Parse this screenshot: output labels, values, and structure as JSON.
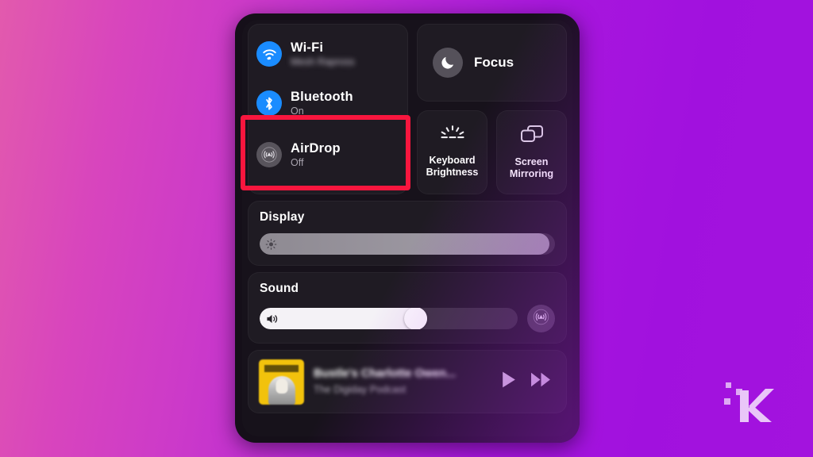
{
  "background": {
    "gradient_from": "#e25aad",
    "gradient_to": "#a313de"
  },
  "panel": {
    "name": "macos-control-center",
    "toggles": [
      {
        "id": "wifi",
        "icon": "wifi-icon",
        "label": "Wi-Fi",
        "status": "Mesh Rapross",
        "status_blurred": true,
        "state": "on"
      },
      {
        "id": "bluetooth",
        "icon": "bluetooth-icon",
        "label": "Bluetooth",
        "status": "On",
        "status_blurred": false,
        "state": "on"
      },
      {
        "id": "airdrop",
        "icon": "airdrop-icon",
        "label": "AirDrop",
        "status": "Off",
        "status_blurred": false,
        "state": "off"
      }
    ],
    "focus": {
      "icon": "moon-icon",
      "label": "Focus"
    },
    "tiles": [
      {
        "id": "keyboard-brightness",
        "icon": "keyboard-brightness-icon",
        "label": "Keyboard\nBrightness",
        "line1": "Keyboard",
        "line2": "Brightness"
      },
      {
        "id": "screen-mirroring",
        "icon": "screen-mirroring-icon",
        "label": "Screen\nMirroring",
        "line1": "Screen",
        "line2": "Mirroring"
      }
    ],
    "display": {
      "title": "Display",
      "icon": "brightness-icon",
      "value": 98
    },
    "sound": {
      "title": "Sound",
      "icon": "speaker-icon",
      "value": 65,
      "output_icon": "airplay-icon"
    },
    "media": {
      "artwork_alt": "podcast-artwork",
      "title": "Bustle's Charlotte Owen...",
      "subtitle": "The Digiday Podcast",
      "title_blurred": true,
      "controls": [
        {
          "id": "play",
          "icon": "play-icon"
        },
        {
          "id": "fast-forward",
          "icon": "fast-forward-icon"
        }
      ]
    }
  },
  "annotation": {
    "type": "highlight-box",
    "target": "airdrop",
    "color": "#f8163e"
  },
  "watermark": {
    "letter": "K",
    "alt": "knowtechie-logo"
  }
}
